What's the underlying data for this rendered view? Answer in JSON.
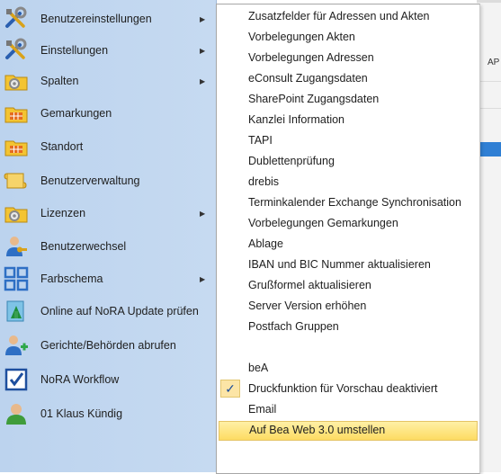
{
  "left_menu": {
    "items": [
      {
        "label": "Benutzereinstellungen",
        "icon": "tools-icon",
        "submenu": true
      },
      {
        "label": "Einstellungen",
        "icon": "tools-icon",
        "submenu": true
      },
      {
        "label": "Spalten",
        "icon": "folder-gear-icon",
        "submenu": true
      },
      {
        "label": "Gemarkungen",
        "icon": "folder-grid-icon",
        "submenu": false
      },
      {
        "label": "Standort",
        "icon": "folder-grid-icon",
        "submenu": false
      },
      {
        "label": "Benutzerverwaltung",
        "icon": "scroll-icon",
        "submenu": false
      },
      {
        "label": "Lizenzen",
        "icon": "folder-gear-icon",
        "submenu": true
      },
      {
        "label": "Benutzerwechsel",
        "icon": "user-key-icon",
        "submenu": false
      },
      {
        "label": "Farbschema",
        "icon": "color-scheme-icon",
        "submenu": true
      },
      {
        "label": "Online auf NoRA Update prüfen",
        "icon": "update-icon",
        "submenu": false
      },
      {
        "label": "Gerichte/Behörden abrufen",
        "icon": "user-add-icon",
        "submenu": false
      },
      {
        "label": "NoRA Workflow",
        "icon": "workflow-check-icon",
        "submenu": false
      },
      {
        "label": "01 Klaus  Kündig",
        "icon": "user-icon",
        "submenu": false
      }
    ]
  },
  "submenu": {
    "items": [
      {
        "label": "Zusatzfelder für Adressen und Akten"
      },
      {
        "label": "Vorbelegungen Akten"
      },
      {
        "label": "Vorbelegungen Adressen"
      },
      {
        "label": "eConsult Zugangsdaten"
      },
      {
        "label": "SharePoint Zugangsdaten"
      },
      {
        "label": "Kanzlei Information"
      },
      {
        "label": "TAPI"
      },
      {
        "label": "Dublettenprüfung"
      },
      {
        "label": "drebis"
      },
      {
        "label": "Terminkalender Exchange Synchronisation"
      },
      {
        "label": "Vorbelegungen Gemarkungen"
      },
      {
        "label": "Ablage"
      },
      {
        "label": "IBAN und BIC Nummer aktualisieren"
      },
      {
        "label": "Grußformel aktualisieren"
      },
      {
        "label": "Server Version erhöhen"
      },
      {
        "label": "Postfach Gruppen"
      },
      {
        "label": "beA"
      },
      {
        "label": "Druckfunktion für Vorschau deaktiviert",
        "checked": true
      },
      {
        "label": "Email"
      },
      {
        "label": "Auf Bea Web 3.0 umstellen",
        "highlighted": true
      }
    ]
  },
  "background_app": {
    "tab_fragment": "AP"
  }
}
